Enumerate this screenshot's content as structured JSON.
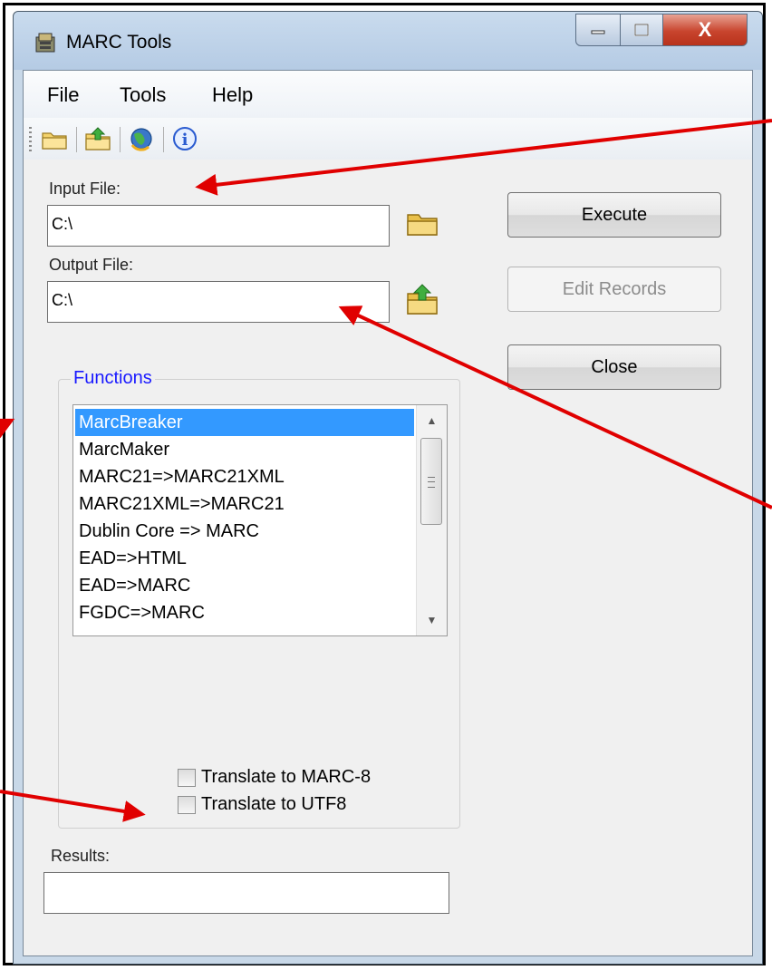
{
  "window": {
    "title": "MARC Tools",
    "close_glyph": "X",
    "controls": [
      "minimize-icon",
      "maximize-icon",
      "close-icon"
    ]
  },
  "menu": {
    "items": [
      {
        "label": "File"
      },
      {
        "label": "Tools"
      },
      {
        "label": "Help"
      }
    ]
  },
  "toolbar": {
    "icons": [
      "open-folder-icon",
      "save-folder-icon",
      "globe-update-icon",
      "info-icon"
    ],
    "info_glyph": "i"
  },
  "input_file": {
    "label": "Input File:",
    "value": "C:\\"
  },
  "output_file": {
    "label": "Output File:",
    "value": "C:\\"
  },
  "buttons": {
    "execute": "Execute",
    "edit_records": "Edit Records",
    "close": "Close"
  },
  "functions": {
    "legend": "Functions",
    "items": [
      {
        "label": "MarcBreaker",
        "selected": true
      },
      {
        "label": "MarcMaker"
      },
      {
        "label": "MARC21=>MARC21XML"
      },
      {
        "label": "MARC21XML=>MARC21"
      },
      {
        "label": "Dublin Core => MARC"
      },
      {
        "label": "EAD=>HTML"
      },
      {
        "label": "EAD=>MARC"
      },
      {
        "label": "FGDC=>MARC"
      }
    ],
    "scroll_up_glyph": "▲",
    "scroll_down_glyph": "▼"
  },
  "options": {
    "translate_marc8": {
      "label": "Translate to MARC-8",
      "checked": false
    },
    "translate_utf8": {
      "label": "Translate to UTF8",
      "checked": false
    }
  },
  "results": {
    "label": "Results:",
    "value": ""
  },
  "colors": {
    "selection": "#3399ff",
    "legend": "#1a1aff",
    "annotation_arrow": "#e00000"
  }
}
